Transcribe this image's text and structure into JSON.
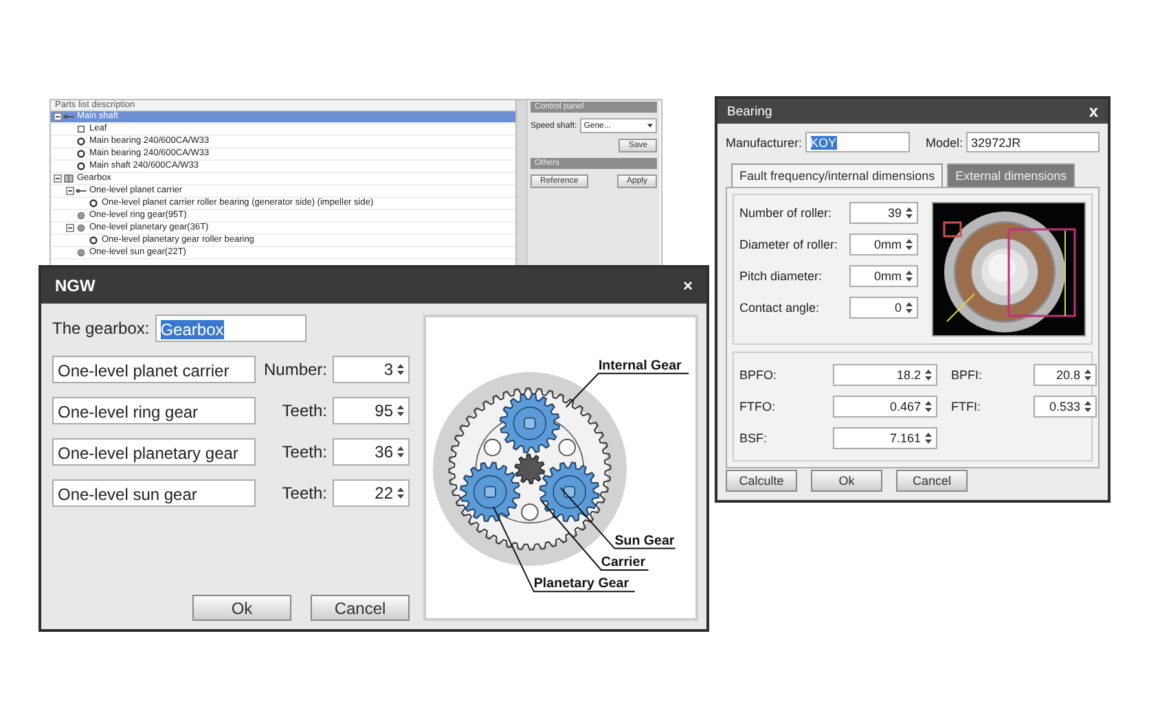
{
  "parts_window": {
    "header": "Parts list description",
    "tree": [
      {
        "label": "Main shaft",
        "kind": "shaft",
        "selected": true,
        "expanded": true,
        "children": [
          {
            "label": "Leaf",
            "kind": "leaf",
            "selected": false
          },
          {
            "label": "Main bearing 240/600CA/W33",
            "kind": "bearing",
            "selected": false
          },
          {
            "label": "Main bearing 240/600CA/W33",
            "kind": "bearing",
            "selected": false
          },
          {
            "label": "Main shaft 240/600CA/W33",
            "kind": "bearing",
            "selected": false
          }
        ]
      },
      {
        "label": "Gearbox",
        "kind": "gearbox",
        "selected": false,
        "expanded": true,
        "children": [
          {
            "label": "One-level planet carrier",
            "kind": "shaft",
            "selected": false,
            "expanded": true,
            "children": [
              {
                "label": "One-level planet carrier roller bearing (generator side) (impeller side)",
                "kind": "bearing",
                "selected": false
              }
            ]
          },
          {
            "label": "One-level ring gear(95T)",
            "kind": "gear",
            "selected": false
          },
          {
            "label": "One-level planetary gear(36T)",
            "kind": "gear",
            "selected": false,
            "expanded": true,
            "children": [
              {
                "label": "One-level planetary gear roller bearing",
                "kind": "bearing",
                "selected": false
              }
            ]
          },
          {
            "label": "One-level sun gear(22T)",
            "kind": "gear",
            "selected": false
          }
        ]
      }
    ],
    "control_panel": {
      "title": "Control panel",
      "speed_shaft_label": "Speed shaft:",
      "speed_shaft_value": "Gene...",
      "save": "Save",
      "others_title": "Others",
      "buttons": [
        "Reference",
        "Apply"
      ]
    }
  },
  "ngw_dialog": {
    "title": "NGW",
    "close": "×",
    "gearbox_label": "The gearbox:",
    "gearbox_value": "Gearbox",
    "gearbox_value_highlighted": true,
    "rows": [
      {
        "name": "One-level planet carrier",
        "label": "Number:",
        "value": "3"
      },
      {
        "name": "One-level ring gear",
        "label": "Teeth:",
        "value": "95"
      },
      {
        "name": "One-level planetary gear",
        "label": "Teeth:",
        "value": "36"
      },
      {
        "name": "One-level sun gear",
        "label": "Teeth:",
        "value": "22"
      }
    ],
    "diagram_labels": [
      "Internal Gear",
      "Sun Gear",
      "Carrier",
      "Planetary Gear"
    ],
    "buttons": [
      "Ok",
      "Cancel"
    ]
  },
  "bearing_dialog": {
    "title": "Bearing",
    "close": "x",
    "manufacturer_label": "Manufacturer:",
    "manufacturer_value": "KOY",
    "manufacturer_value_highlighted": true,
    "model_label": "Model:",
    "model_value": "32972JR",
    "tabs": [
      {
        "label": "Fault frequency/internal dimensions",
        "selected": true
      },
      {
        "label": "External dimensions",
        "selected": false
      }
    ],
    "fields": [
      {
        "label": "Number of roller:",
        "value": "39"
      },
      {
        "label": "Diameter of roller:",
        "value": "0mm"
      },
      {
        "label": "Pitch diameter:",
        "value": "0mm"
      },
      {
        "label": "Contact angle:",
        "value": "0"
      }
    ],
    "results": [
      {
        "label": "BPFO:",
        "value": "18.2"
      },
      {
        "label": "BPFI:",
        "value": "20.8"
      },
      {
        "label": "FTFO:",
        "value": "0.467"
      },
      {
        "label": "FTFI:",
        "value": "0.533"
      },
      {
        "label": "BSF:",
        "value": "7.161"
      }
    ],
    "buttons": [
      "Calculte",
      "Ok",
      "Cancel"
    ]
  }
}
